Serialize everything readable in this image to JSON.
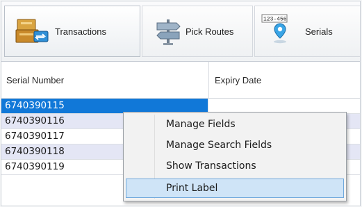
{
  "toolbar": {
    "buttons": [
      {
        "label": "Transactions",
        "icon": "transactions-icon"
      },
      {
        "label": "Pick Routes",
        "icon": "signpost-icon"
      },
      {
        "label": "Serials",
        "icon": "serial-location-icon",
        "icon_text": "123-456"
      }
    ]
  },
  "grid": {
    "columns": [
      "Serial Number",
      "Expiry Date"
    ],
    "rows": [
      {
        "serial": "6740390115",
        "selected": true
      },
      {
        "serial": "6740390116"
      },
      {
        "serial": "6740390117"
      },
      {
        "serial": "6740390118"
      },
      {
        "serial": "6740390119"
      }
    ]
  },
  "context_menu": {
    "items": [
      {
        "label": "Manage Fields"
      },
      {
        "label": "Manage Search Fields"
      },
      {
        "label": "Show Transactions"
      },
      {
        "label": "Print Label",
        "highlighted": true
      }
    ]
  },
  "colors": {
    "selection": "#1178d8",
    "alt_row": "#e4e6f5",
    "menu_highlight": "#cfe4f7",
    "menu_highlight_border": "#6fa8dc"
  }
}
